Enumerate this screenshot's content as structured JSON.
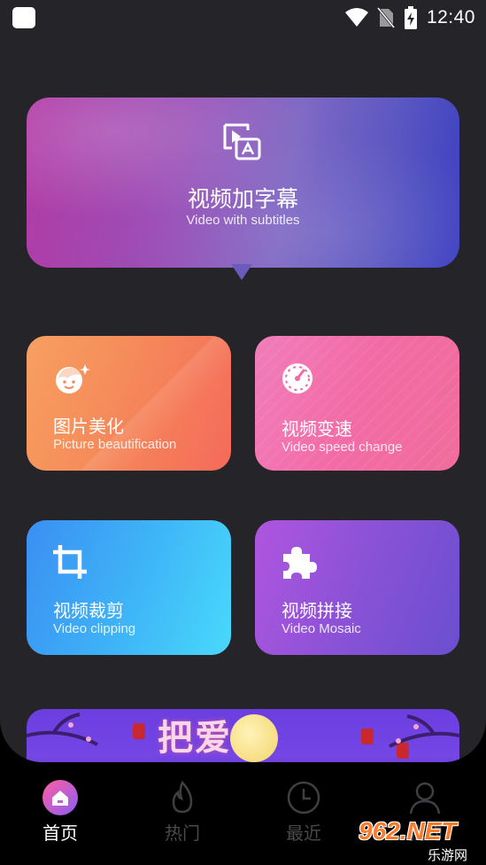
{
  "status_bar": {
    "time": "12:40",
    "icons": [
      "app-icon",
      "wifi-icon",
      "no-sim-icon",
      "battery-charging-icon"
    ]
  },
  "hero": {
    "title": "视频加字幕",
    "subtitle": "Video with subtitles",
    "icon": "video-subtitle-icon"
  },
  "features": [
    {
      "title": "图片美化",
      "subtitle": "Picture beautification",
      "icon": "face-sparkle-icon",
      "color": "#f58a5a"
    },
    {
      "title": "视频变速",
      "subtitle": "Video speed change",
      "icon": "speedometer-icon",
      "color": "#f36ba6"
    },
    {
      "title": "视频裁剪",
      "subtitle": "Video clipping",
      "icon": "crop-icon",
      "color": "#3fb6f7"
    },
    {
      "title": "视频拼接",
      "subtitle": "Video Mosaic",
      "icon": "puzzle-icon",
      "color": "#8a52d6"
    }
  ],
  "banner": {
    "text": "把爱"
  },
  "bottom_nav": [
    {
      "label": "首页",
      "icon": "home-icon",
      "active": true
    },
    {
      "label": "热门",
      "icon": "flame-icon",
      "active": false
    },
    {
      "label": "最近",
      "icon": "clock-icon",
      "active": false
    },
    {
      "label": "我的",
      "icon": "user-icon",
      "active": false
    }
  ],
  "watermark": {
    "main": "962.NET",
    "sub": "乐游网"
  },
  "colors": {
    "background": "#252429",
    "nav_background": "#000000",
    "active_tab_gradient_start": "#ff5fa0",
    "active_tab_gradient_end": "#8b5cf6"
  }
}
